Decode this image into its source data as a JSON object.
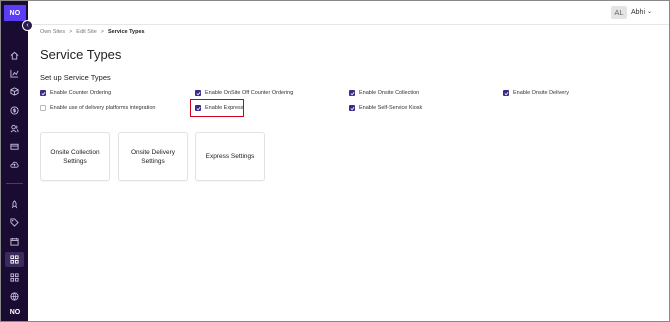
{
  "brand": {
    "logo_text": "NO",
    "logo_bottom_text": "NO"
  },
  "sidebar": {
    "collapse_glyph": "‹",
    "icons": [
      "home-icon",
      "chart-icon",
      "box-icon",
      "dollar-icon",
      "users-icon",
      "card-icon",
      "cloud-icon",
      "rocket-icon",
      "tag-icon",
      "calendar-icon",
      "grid-icon",
      "apps-icon",
      "globe-icon"
    ],
    "active": "grid-icon"
  },
  "header": {
    "avatar_initials": "AL",
    "user_name": "Abhi",
    "chevron": "⌄"
  },
  "breadcrumb": {
    "item1": "Own Sites",
    "sep1": ">",
    "item2": "Edit Site",
    "sep2": ">",
    "current": "Service Types"
  },
  "page": {
    "title": "Service Types",
    "section_title": "Set up Service Types"
  },
  "options": {
    "counter_ordering": {
      "label": "Enable Counter Ordering",
      "checked": true
    },
    "onsite_off_counter": {
      "label": "Enable OnSite Off Counter Ordering",
      "checked": true
    },
    "onsite_collection": {
      "label": "Enable Onsite Collection",
      "checked": true
    },
    "onsite_delivery": {
      "label": "Enable Onsite Delivery",
      "checked": true
    },
    "delivery_platforms": {
      "label": "Enable use of delivery platforms integration",
      "checked": false
    },
    "express": {
      "label": "Enable Express",
      "checked": true
    },
    "self_service_kiosk": {
      "label": "Enable Self-Service Kiosk",
      "checked": true
    }
  },
  "cards": {
    "onsite_collection": "Onsite Collection Settings",
    "onsite_delivery": "Onsite Delivery Settings",
    "express": "Express Settings"
  },
  "colors": {
    "sidebar_bg": "#1a0b33",
    "brand": "#5b3df5",
    "checkbox": "#3f2a8c",
    "highlight": "#d0021b"
  }
}
